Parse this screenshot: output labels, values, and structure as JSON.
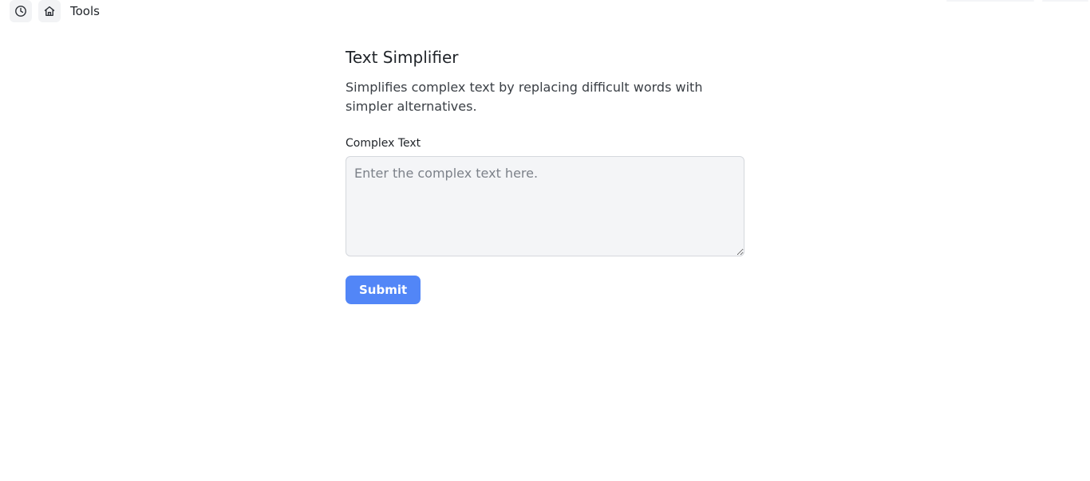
{
  "topbar": {
    "history_icon": "clock-icon",
    "home_icon": "home-icon",
    "tools_label": "Tools"
  },
  "page": {
    "title": "Text Simplifier",
    "description": "Simplifies complex text by replacing difficult words with simpler alternatives."
  },
  "form": {
    "complex_text": {
      "label": "Complex Text",
      "placeholder": "Enter the complex text here.",
      "value": ""
    },
    "submit_label": "Submit"
  },
  "colors": {
    "accent": "#5286f7",
    "input_bg": "#f4f5f7",
    "icon_button_bg": "#f2f3f5"
  }
}
